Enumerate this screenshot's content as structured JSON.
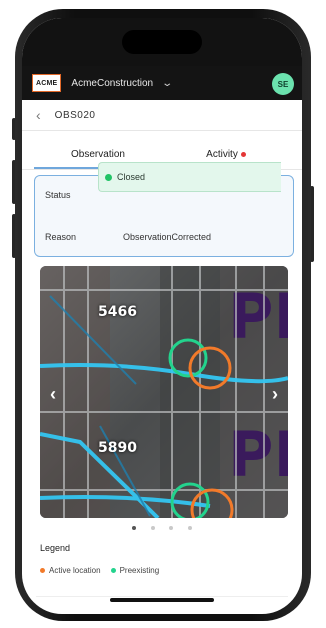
{
  "header": {
    "logo_text": "ACME",
    "project_name": "AcmeConstruction",
    "avatar_initials": "SE"
  },
  "subheader": {
    "record_id": "OBS020"
  },
  "tabs": [
    {
      "label": "Observation",
      "active": true
    },
    {
      "label": "Activity",
      "has_notification": true
    }
  ],
  "details": {
    "status_label": "Status",
    "status_value": "Closed",
    "status_color": "#22c366",
    "reason_label": "Reason",
    "reason_value": "ObservationCorrected"
  },
  "image": {
    "tags": [
      "5466",
      "5890"
    ],
    "prev_icon": "chevron-left-icon",
    "next_icon": "chevron-right-icon",
    "page_count": 4,
    "current_page": 1
  },
  "legend": {
    "title": "Legend",
    "items": [
      {
        "label": "Active location",
        "color": "#f27a2a"
      },
      {
        "label": "Preexisting",
        "color": "#23d38d"
      }
    ]
  },
  "colors": {
    "accent_blue": "#6fa7dc",
    "notification_red": "#e43636",
    "avatar_green": "#6be2ae"
  }
}
